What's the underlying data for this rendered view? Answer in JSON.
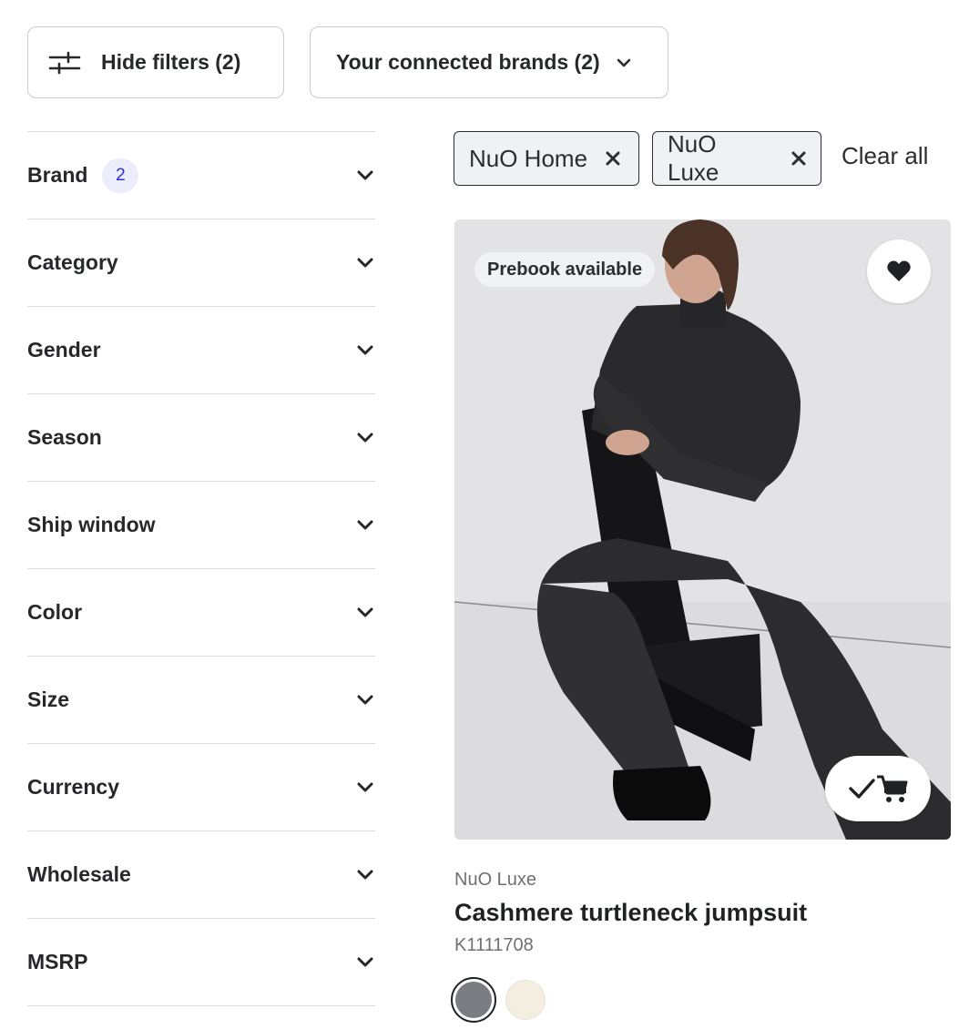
{
  "toolbar": {
    "hide_filters_label": "Hide filters (2)",
    "connected_brands_label": "Your connected brands (2)"
  },
  "filters": [
    {
      "label": "Brand",
      "count": "2"
    },
    {
      "label": "Category"
    },
    {
      "label": "Gender"
    },
    {
      "label": "Season"
    },
    {
      "label": "Ship window"
    },
    {
      "label": "Color"
    },
    {
      "label": "Size"
    },
    {
      "label": "Currency"
    },
    {
      "label": "Wholesale"
    },
    {
      "label": "MSRP"
    }
  ],
  "active_filters": {
    "chips": [
      {
        "label": "NuO Home"
      },
      {
        "label": "NuO Luxe"
      }
    ],
    "clear_all_label": "Clear all"
  },
  "product": {
    "badge": "Prebook available",
    "brand": "NuO Luxe",
    "title": "Cashmere turtleneck jumpsuit",
    "sku": "K1111708",
    "favorited": true,
    "in_cart": true,
    "image_alt": "Model in charcoal cashmere turtleneck jumpsuit seated on a black block",
    "swatches": [
      {
        "color": "#7c7c83",
        "selected": true
      },
      {
        "color": "#f3eedf",
        "selected": false
      }
    ]
  },
  "icons": {
    "filter": "sliders-icon",
    "dropdown": "chevron-down-icon",
    "remove": "close-icon",
    "favorite": "heart-icon",
    "cart": "cart-check-icon"
  },
  "colors": {
    "badge_blue": "#2a2ed6",
    "badge_bg": "#ececfa",
    "border": "#d9dadd",
    "text": "#1f2124"
  }
}
